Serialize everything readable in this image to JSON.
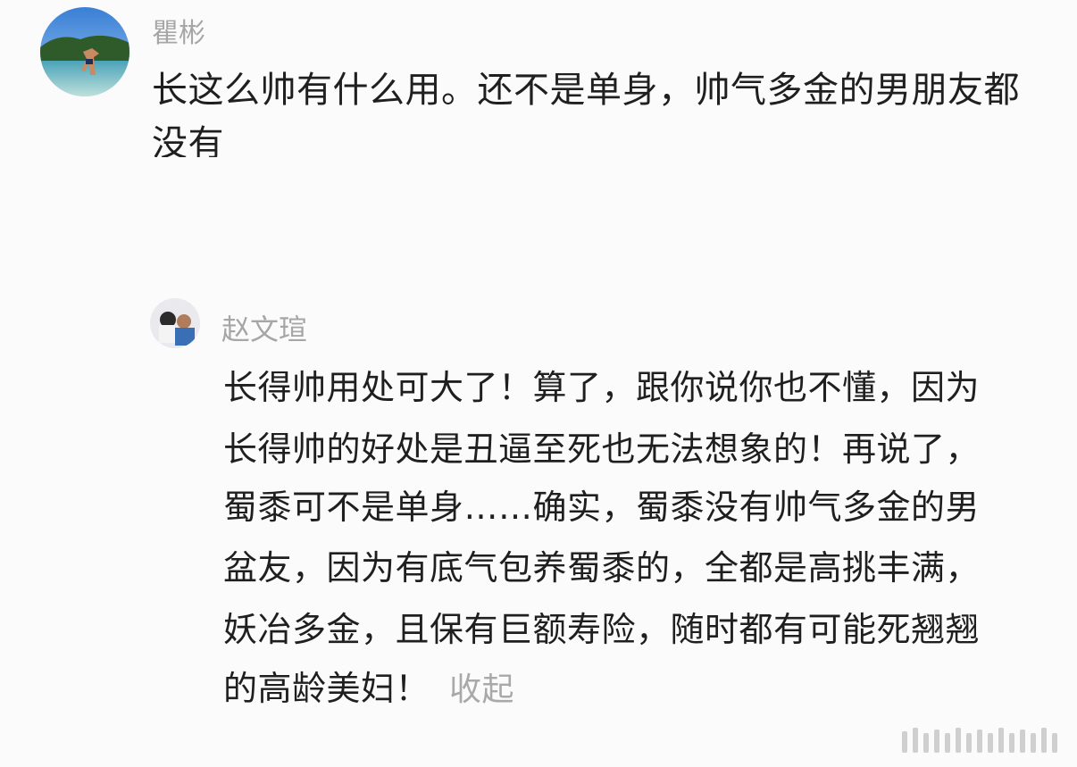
{
  "comments": [
    {
      "username": "瞿彬",
      "lines": [
        "长这么帅有什么用。还不是单身，帅气多金的男朋友都",
        "没有"
      ]
    }
  ],
  "reply": {
    "username": "赵文瑄",
    "lines": [
      "长得帅用处可大了！算了，跟你说你也不懂，因为",
      "长得帅的好处是丑逼至死也无法想象的！再说了，",
      "蜀黍可不是单身……确实，蜀黍没有帅气多金的男",
      "盆友，因为有底气包养蜀黍的，全都是高挑丰满，",
      "妖冶多金，且保有巨额寿险，随时都有可能死翘翘",
      "的高龄美妇！"
    ],
    "collapse_label": "收起"
  },
  "colors": {
    "background": "#fbfbfb",
    "username": "#a6a6a6",
    "text": "#1f1f1f",
    "collapse": "#a9a9a9"
  }
}
